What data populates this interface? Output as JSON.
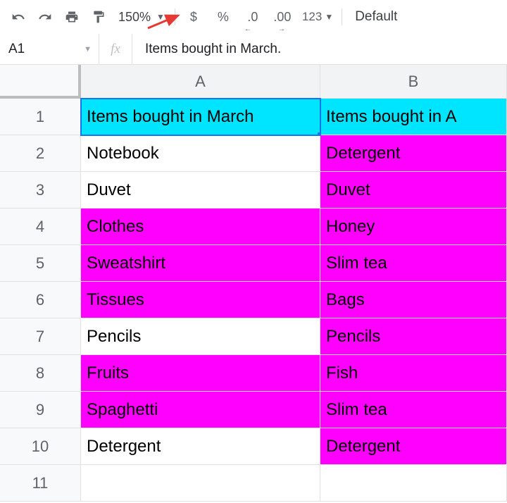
{
  "toolbar": {
    "zoom": "150%",
    "fmt_123": "123",
    "font": "Default"
  },
  "formula_bar": {
    "name_box": "A1",
    "fx": "fx",
    "formula": "Items bought in March."
  },
  "columns": [
    "A",
    "B"
  ],
  "rows": [
    {
      "n": "1",
      "a": {
        "v": "Items bought in March",
        "bg": "cyan",
        "sel": true
      },
      "b": {
        "v": "Items bought in A",
        "bg": "cyan"
      }
    },
    {
      "n": "2",
      "a": {
        "v": "Notebook",
        "bg": "white"
      },
      "b": {
        "v": "Detergent",
        "bg": "magenta"
      }
    },
    {
      "n": "3",
      "a": {
        "v": "Duvet",
        "bg": "white"
      },
      "b": {
        "v": "Duvet",
        "bg": "magenta"
      }
    },
    {
      "n": "4",
      "a": {
        "v": "Clothes",
        "bg": "magenta"
      },
      "b": {
        "v": "Honey",
        "bg": "magenta"
      }
    },
    {
      "n": "5",
      "a": {
        "v": "Sweatshirt",
        "bg": "magenta"
      },
      "b": {
        "v": "Slim tea",
        "bg": "magenta"
      }
    },
    {
      "n": "6",
      "a": {
        "v": "Tissues",
        "bg": "magenta"
      },
      "b": {
        "v": "Bags",
        "bg": "magenta"
      }
    },
    {
      "n": "7",
      "a": {
        "v": "Pencils",
        "bg": "white"
      },
      "b": {
        "v": "Pencils",
        "bg": "magenta"
      }
    },
    {
      "n": "8",
      "a": {
        "v": "Fruits",
        "bg": "magenta"
      },
      "b": {
        "v": "Fish",
        "bg": "magenta"
      }
    },
    {
      "n": "9",
      "a": {
        "v": "Spaghetti",
        "bg": "magenta"
      },
      "b": {
        "v": "Slim tea",
        "bg": "magenta"
      }
    },
    {
      "n": "10",
      "a": {
        "v": "Detergent",
        "bg": "white"
      },
      "b": {
        "v": "Detergent",
        "bg": "magenta"
      }
    },
    {
      "n": "11",
      "a": {
        "v": "",
        "bg": "white"
      },
      "b": {
        "v": "",
        "bg": "white"
      }
    }
  ]
}
